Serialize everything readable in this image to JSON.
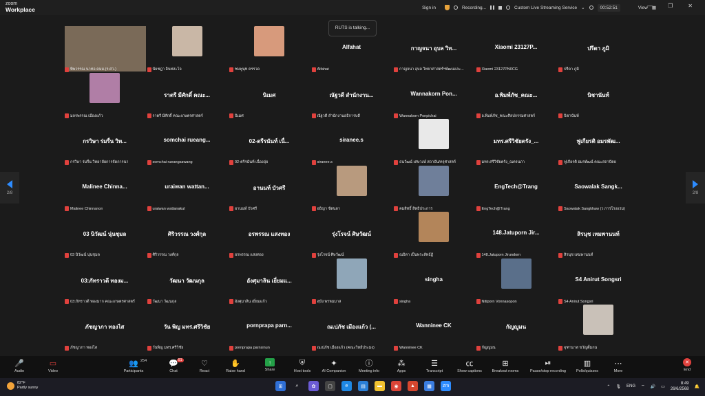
{
  "app": {
    "brand_top": "zoom",
    "brand_bottom": "Workplace"
  },
  "titlebar": {
    "sign_in": "Sign in",
    "recording": "Recording...",
    "streaming": "Custom Live Streaming Service",
    "timer": "00:52:51",
    "view": "View"
  },
  "toast": "RUTS is talking...",
  "pager": {
    "left": "2/8",
    "right": "2/8"
  },
  "tiles": [
    {
      "display": "",
      "label": "ทิพวรรณ นาทอ คมม.(ร.ศว.)",
      "photo": "#7a6a58",
      "big": true
    },
    {
      "display": "",
      "label": "นัยชฎา อินทสะโจ",
      "photo": "#c9b7a6"
    },
    {
      "display": "",
      "label": "ชมพูนุท ครรวด",
      "photo": "#d79a7c"
    },
    {
      "display": "Alfahat",
      "label": "Alfahat"
    },
    {
      "display": "กาญจนา อุบล วิท...",
      "label": "กาญจนา อุบล วิทยาศาสตร์ฯพัฒนและ..."
    },
    {
      "display": "Xiaomi 23127P...",
      "label": "Xiaomi 23127PN0CG"
    },
    {
      "display": "ปรีดา ภูมิ",
      "label": "ปรีดา ภูมิ"
    },
    {
      "display": "",
      "label": "มลรพรรณ เมืองแก้ว",
      "photo": "#b07ea6"
    },
    {
      "display": "ราตรี มีศักดิ์ คณะ...",
      "label": "ราตรี มีศักดิ์ คณะเกษตรศาสตร์"
    },
    {
      "display": "นิเมศ",
      "label": "นิเมศ"
    },
    {
      "display": "ณัฐวดี สำนักงาน...",
      "label": "ณัฐวดี สำนักงานอธิการบดี"
    },
    {
      "display": "Wannakorn Pon...",
      "label": "Wannakorn Ponpichai"
    },
    {
      "display": "อ.พิมพ์ภัช_คณะ...",
      "label": "อ.พิมพ์ภัช_คณะศิลปกรรมศาสตร์"
    },
    {
      "display": "นิชานันท์",
      "label": "นิชานันท์"
    },
    {
      "display": "กรวิษา ร่มรื่น วิท...",
      "label": "กรวิษา ร่มรื่น วิทยาลัยการจัดการนา"
    },
    {
      "display": "somchai rueang...",
      "label": "somchai rueangsawang"
    },
    {
      "display": "02-ตรีรนันท์ เนื่...",
      "label": "02-ตรีรนันท์ เนื่องอุ่ย"
    },
    {
      "display": "siranee.s",
      "label": "siranee.s"
    },
    {
      "display": "",
      "label": "ธนวัฒน์ เศษวงษ์ สถาบัน/ครุศาสตร์",
      "photo": "#e9e9e9"
    },
    {
      "display": "มทร.ศรีวิชัยตรัง_...",
      "label": "มทร.ศรีวิชัยตรัง_ณตรนภา"
    },
    {
      "display": "ฟูเกียรติ อมรพัฒ...",
      "label": "ฟูเกียรติ อมรพัฒน์ คณะสถาปัตย"
    },
    {
      "display": "Malinee Chinna...",
      "label": "Malinee Chinnanon"
    },
    {
      "display": "uraiwan wattan...",
      "label": "uraiwan wattanakul"
    },
    {
      "display": "อานนท์ บัวศรี",
      "label": "อานนท์ บัวศรี"
    },
    {
      "display": "",
      "label": "อธิญา ขัตนลา",
      "photo": "#b89a7e"
    },
    {
      "display": "",
      "label": "คมสิทธิ์ สิทธิประการ",
      "photo": "#6f7f9a"
    },
    {
      "display": "EngTech@Trang",
      "label": "EngTech@Trang"
    },
    {
      "display": "Saowalak Sangk...",
      "label": "Saowalak Sangkhaw (ว.การโรงแรม)"
    },
    {
      "display": "03 นิวัฒน์ นุ่นชุมล",
      "label": "03 นิวัฒน์ นุ่นชุมล"
    },
    {
      "display": "ศิริวรรณ วงศ์กุล",
      "label": "ศิริวรรณ วงศ์กุล"
    },
    {
      "display": "อรพรรณ แสงทอง",
      "label": "อรพรรณ แสงทอง"
    },
    {
      "display": "รุ่งโรจน์ ศิษวัฒน์",
      "label": "รุ่งโรจน์ ศิษวัฒน์"
    },
    {
      "display": "",
      "label": "ณธิดา เป็นพระลัทธ์ฏิ",
      "photo": "#b3855a"
    },
    {
      "display": "148.Jatuporn Jir...",
      "label": "148.Jatuporn Jirundorn"
    },
    {
      "display": "สิรนุช เหมพานนท์",
      "label": "สิรนุช เหมพานนท์"
    },
    {
      "display": "03:ภัทราวดี ทองม...",
      "label": "03:ภัทราวดี ทองมาก คณะเกษตรศาสตร์"
    },
    {
      "display": "วัฒนา วัฒนกุล",
      "label": "วัฒนา วัฒนกุล"
    },
    {
      "display": "อังศุมาลิน เยี่ยมแ...",
      "label": "อังศุมาลิน เยี่ยมแก้ว"
    },
    {
      "display": "",
      "label": "สุบัง พรหมมาส",
      "photo": "#8fa6b8"
    },
    {
      "display": "singha",
      "label": "singha"
    },
    {
      "display": "",
      "label": "Nitiporn Vonnasopon",
      "photo": "#5a6f8a"
    },
    {
      "display": "S4 Anirut Songsri",
      "label": "S4 Anirut Songsri"
    },
    {
      "display": "ภัชญาภา ทองไส",
      "label": "ภัชญาภา ทองไส"
    },
    {
      "display": "วัน พิญ มทร.ศรีวิชัย",
      "label": "วันพิญ มทร.ศรีวิชัย"
    },
    {
      "display": "pornprapa parn...",
      "label": "pornprapa parnsinun"
    },
    {
      "display": "ณเปภัช เมืองแก้ว (...",
      "label": "ณเปภัช เมืองแก้ว (คณะวิทย์ประมง)"
    },
    {
      "display": "Wanninee CK",
      "label": "Wanninee CK"
    },
    {
      "display": "กัญญูมน",
      "label": "กัญญูมน"
    },
    {
      "display": "",
      "label": "จุฑามาส ขวัญดื่มกน",
      "photo": "#c9c1b8"
    }
  ],
  "toolbar": {
    "audio": "Audio",
    "video": "Video",
    "participants": "Participants",
    "participants_count": "254",
    "chat": "Chat",
    "chat_badge": "51",
    "react": "React",
    "raise_hand": "Raise hand",
    "share": "Share",
    "host_tools": "Host tools",
    "ai_companion": "AI Companion",
    "meeting_info": "Meeting info",
    "apps": "Apps",
    "transcript": "Transcript",
    "show_captions": "Show captions",
    "breakout_rooms": "Breakout rooms",
    "pause_recording": "Pause/stop recording",
    "polls": "Polls/quizzes",
    "more": "More",
    "end": "End"
  },
  "taskbar": {
    "temp": "82°F",
    "weather": "Partly sunny",
    "lang": "ENG",
    "time": "8:49",
    "date": "26/6/2568",
    "notif": "1"
  }
}
